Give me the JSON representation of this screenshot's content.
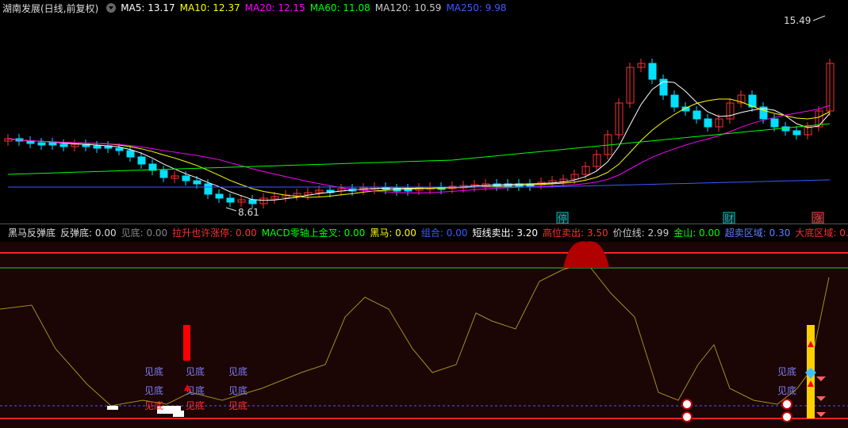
{
  "top": {
    "title": "湖南发展(日线,前复权)",
    "ma": [
      {
        "label": "MA5: 13.17",
        "color": "#ffffff"
      },
      {
        "label": "MA10: 12.37",
        "color": "#ffff00"
      },
      {
        "label": "MA20: 12.15",
        "color": "#ff00ff"
      },
      {
        "label": "MA60: 11.08",
        "color": "#00ff00"
      },
      {
        "label": "MA120: 10.59",
        "color": "#cccccc"
      },
      {
        "label": "MA250: 9.98",
        "color": "#3b5bff"
      }
    ],
    "high_label": "15.49",
    "low_label": "8.61",
    "markers": [
      {
        "text": "停",
        "color": "#00c0c0"
      },
      {
        "text": "财",
        "color": "#00c0c0"
      },
      {
        "text": "涨",
        "color": "#ff4040"
      }
    ]
  },
  "indicator": {
    "title": "黑马反弹底",
    "items": [
      {
        "label": "反弹底: 0.00",
        "color": "#dddddd"
      },
      {
        "label": "见底: 0.00",
        "color": "#888888"
      },
      {
        "label": "拉升也许涨停: 0.00",
        "color": "#ff3030"
      },
      {
        "label": "MACD零轴上金叉: 0.00",
        "color": "#00ff00"
      },
      {
        "label": "黑马: 0.00",
        "color": "#ffff00"
      },
      {
        "label": "组合: 0.00",
        "color": "#3b5bff"
      },
      {
        "label": "短线卖出: 3.20",
        "color": "#ffffff"
      },
      {
        "label": "高位卖出: 3.50",
        "color": "#ff3030"
      },
      {
        "label": "价位线: 2.99",
        "color": "#cccccc"
      },
      {
        "label": "金山: 0.00",
        "color": "#00ff00"
      },
      {
        "label": "超卖区域: 0.30",
        "color": "#5f7fff"
      },
      {
        "label": "大底区域: 0.00",
        "color": "#ff3030"
      }
    ],
    "signal_text": "见底"
  },
  "colors": {
    "up": "#ff3030",
    "down": "#00e0ff"
  }
}
